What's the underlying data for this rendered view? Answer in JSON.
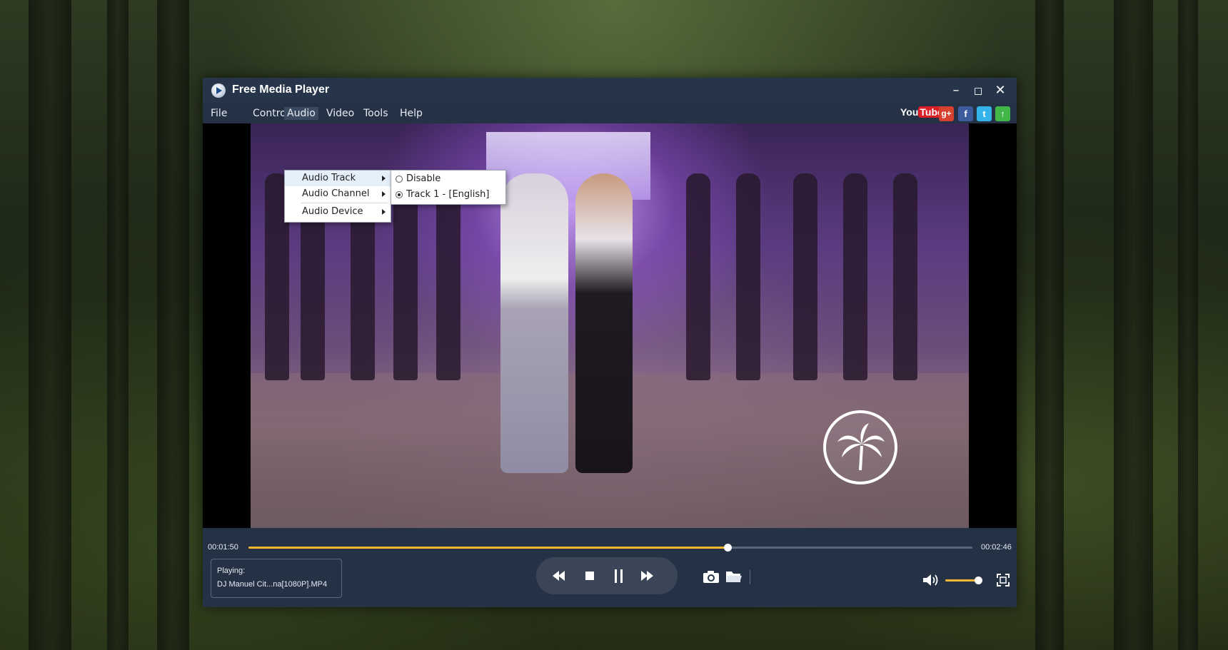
{
  "window": {
    "title": "Free Media Player",
    "controls": {
      "minimize": "–",
      "maximize": "◻",
      "close": "✕"
    }
  },
  "menubar": {
    "items": [
      {
        "label": "File"
      },
      {
        "label": "Controls"
      },
      {
        "label": "Audio",
        "active": true
      },
      {
        "label": "Video"
      },
      {
        "label": "Tools"
      },
      {
        "label": "Help"
      }
    ]
  },
  "social": {
    "youtube_you": "You",
    "youtube_tube": "Tube",
    "gplus": "g+",
    "facebook": "f",
    "twitter": "t",
    "upload": "↑"
  },
  "audio_menu": {
    "items": [
      {
        "label": "Audio Track",
        "has_submenu": true,
        "highlighted": true
      },
      {
        "label": "Audio Channel",
        "has_submenu": true
      },
      {
        "label": "Audio Device",
        "has_submenu": true
      }
    ]
  },
  "audio_track_submenu": {
    "items": [
      {
        "label": "Disable",
        "selected": false
      },
      {
        "label": "Track 1 - [English]",
        "selected": true
      }
    ]
  },
  "playback": {
    "current_time": "00:01:50",
    "total_time": "00:02:46",
    "progress": 0.662,
    "playing_label": "Playing:",
    "file_name": "DJ Manuel Cit...na[1080P].MP4",
    "volume": 0.88
  },
  "icons": {
    "rewind": "rewind-icon",
    "stop": "stop-icon",
    "pause": "pause-icon",
    "fast_forward": "fast-forward-icon",
    "snapshot": "camera-icon",
    "open": "folder-icon",
    "volume": "speaker-icon",
    "fullscreen": "fullscreen-icon"
  },
  "colors": {
    "accent": "#f2b632",
    "window_bg": "#253246",
    "menu_highlight": "#e5effa"
  }
}
